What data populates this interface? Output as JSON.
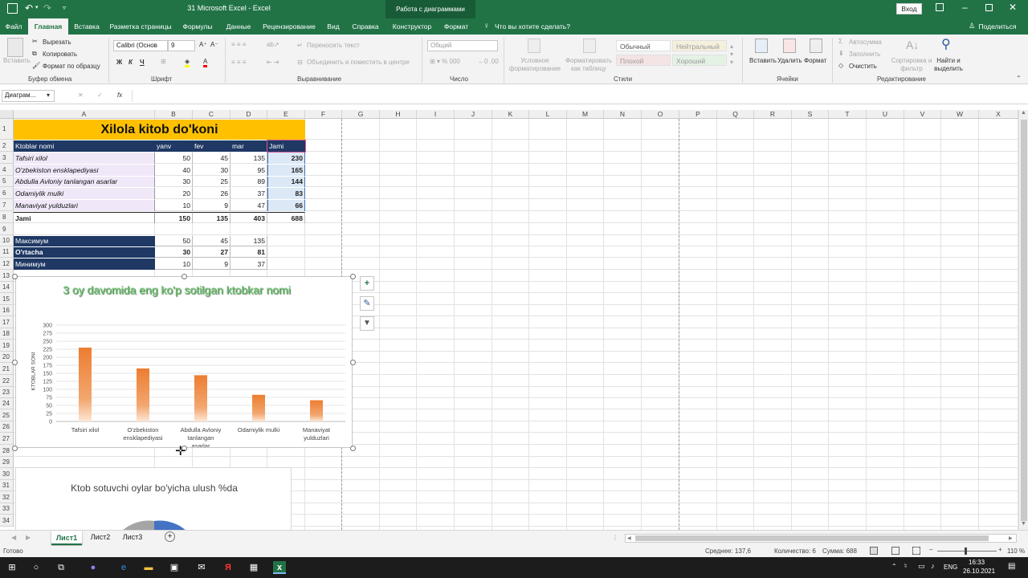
{
  "titlebar": {
    "title": "31 Microsoft Excel  -  Excel",
    "context": "Работа с диаграммами",
    "signin": "Вход"
  },
  "ribbon_tabs": [
    "Файл",
    "Главная",
    "Вставка",
    "Разметка страницы",
    "Формулы",
    "Данные",
    "Рецензирование",
    "Вид",
    "Справка",
    "Конструктор",
    "Формат"
  ],
  "tell_me": "Что вы хотите сделать?",
  "share": "Поделиться",
  "ribbon": {
    "clipboard": {
      "paste": "Вставить",
      "cut": "Вырезать",
      "copy": "Копировать",
      "format_painter": "Формат по образцу",
      "label": "Буфер обмена"
    },
    "font": {
      "name": "Calibri (Основ",
      "size": "9",
      "bold": "Ж",
      "italic": "К",
      "underline": "Ч",
      "label": "Шрифт"
    },
    "alignment": {
      "wrap": "Переносить текст",
      "merge": "Объединить и поместить в центре",
      "label": "Выравнивание"
    },
    "number": {
      "format": "Общий",
      "label": "Число"
    },
    "styles": {
      "cond_format": "Условное форматирование",
      "format_table": "Форматировать как таблицу",
      "normal": "Обычный",
      "neutral": "Нейтральный",
      "bad": "Плохой",
      "good": "Хороший",
      "label": "Стили"
    },
    "cells": {
      "insert": "Вставить",
      "delete": "Удалить",
      "format": "Формат",
      "label": "Ячейки"
    },
    "editing": {
      "autosum": "Автосумма",
      "fill": "Заполнить",
      "clear": "Очистить",
      "sort": "Сортировка и фильтр",
      "find": "Найти и выделить",
      "label": "Редактирование"
    }
  },
  "formula_bar": {
    "name_box": "Диаграм...",
    "fx": "fx",
    "value": ""
  },
  "sheet": {
    "columns": [
      "A",
      "B",
      "C",
      "D",
      "E",
      "F",
      "G",
      "H",
      "I",
      "J",
      "K",
      "L",
      "M",
      "N",
      "O",
      "P",
      "Q",
      "R",
      "S",
      "T",
      "U",
      "V",
      "W",
      "X"
    ],
    "rows": [
      "1",
      "2",
      "3",
      "4",
      "5",
      "6",
      "7",
      "8",
      "9",
      "10",
      "11",
      "12",
      "13",
      "14",
      "15",
      "16",
      "17",
      "18",
      "19",
      "20",
      "21",
      "22",
      "23",
      "24",
      "25",
      "26",
      "27",
      "28",
      "29",
      "30",
      "31",
      "32",
      "33",
      "34"
    ],
    "title": "Xilola kitob do'koni",
    "headers": [
      "Ktoblar nomi",
      "yanv",
      "fev",
      "mar",
      "Jami"
    ],
    "data": [
      [
        "Tafsiri xilol",
        "50",
        "45",
        "135",
        "230"
      ],
      [
        "O'zbekiston ensklapediyasi",
        "40",
        "30",
        "95",
        "165"
      ],
      [
        "Abdulla Avloniy tanlangan asarlar",
        "30",
        "25",
        "89",
        "144"
      ],
      [
        "Odamiylik mulki",
        "20",
        "26",
        "37",
        "83"
      ],
      [
        "Manaviyat yulduzlari",
        "10",
        "9",
        "47",
        "66"
      ]
    ],
    "total": [
      "Jami",
      "150",
      "135",
      "403",
      "688"
    ],
    "stats": [
      [
        "Максимум",
        "50",
        "45",
        "135"
      ],
      [
        "O'rtacha",
        "30",
        "27",
        "81"
      ],
      [
        "Минимум",
        "10",
        "9",
        "37"
      ]
    ]
  },
  "chart_data": [
    {
      "type": "bar",
      "title": "3 oy davomida eng ko'p sotilgan ktobkar nomi",
      "ylabel": "KTOBLAR SONI",
      "xlabel": "",
      "categories": [
        "Tafsiri xilol",
        "O'zbekiston ensklapediyasi",
        "Abdulla Avloniy tanlangan asarlar",
        "Odamiylik mulki",
        "Manaviyat yulduzlari"
      ],
      "values": [
        230,
        165,
        144,
        83,
        66
      ],
      "ylim": [
        0,
        300
      ],
      "yticks": [
        "300",
        "275",
        "250",
        "225",
        "200",
        "175",
        "150",
        "125",
        "100",
        "75",
        "50",
        "25",
        "0"
      ],
      "grid": true,
      "color": "#ed7d31"
    },
    {
      "type": "pie",
      "title": "Ktob sotuvchi oylar bo'yicha ulush %da"
    }
  ],
  "sheet_tabs": [
    "Лист1",
    "Лист2",
    "Лист3"
  ],
  "status": {
    "ready": "Готово",
    "average": "Среднее: 137,6",
    "count": "Количество: 6",
    "sum": "Сумма: 688",
    "zoom": "110 %"
  },
  "taskbar": {
    "lang": "ENG",
    "time": "16:33",
    "date": "26.10.2021"
  },
  "colors": {
    "excel_green": "#217346",
    "navy": "#1f3864",
    "title_fill": "#ffc000",
    "bar": "#ed7d31"
  }
}
